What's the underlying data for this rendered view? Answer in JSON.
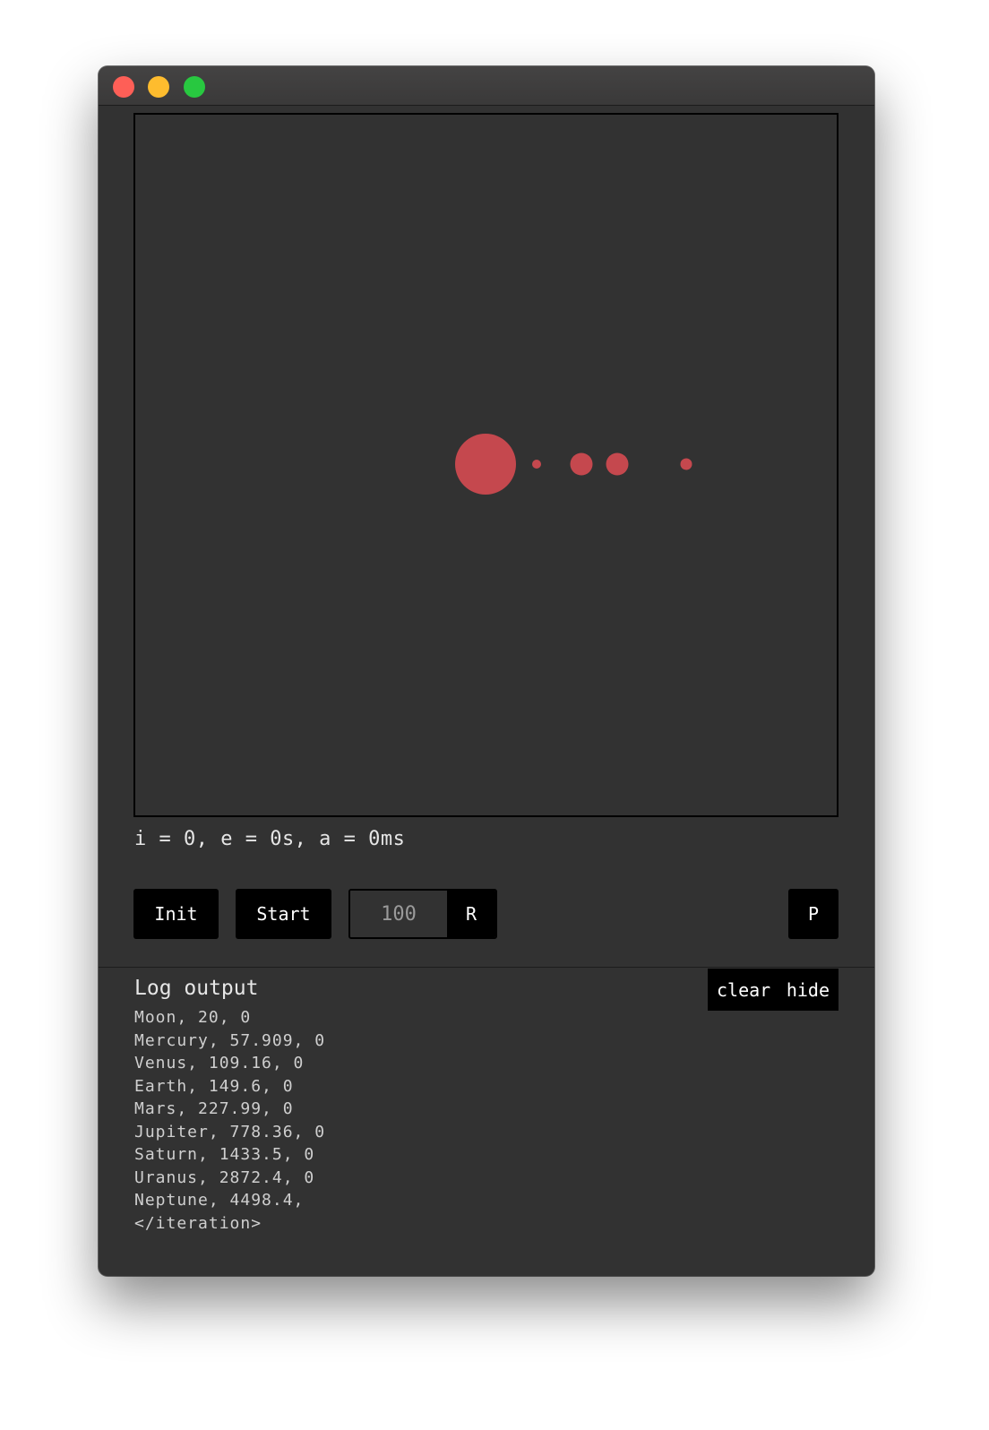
{
  "stats": {
    "text": "i = 0, e = 0s, a = 0ms"
  },
  "controls": {
    "init_label": "Init",
    "start_label": "Start",
    "rate_value": "100",
    "rate_button_label": "R",
    "p_label": "P"
  },
  "canvas": {
    "body_color": "#c5484e",
    "background": "#323232"
  },
  "log": {
    "title": "Log output",
    "clear_label": "clear",
    "hide_label": "hide",
    "lines": [
      "Moon, 20, 0",
      "Mercury, 57.909, 0",
      "Venus, 109.16, 0",
      "Earth, 149.6, 0",
      "Mars, 227.99, 0",
      "Jupiter, 778.36, 0",
      "Saturn, 1433.5, 0",
      "Uranus, 2872.4, 0",
      "Neptune, 4498.4,",
      "</iteration>"
    ]
  }
}
